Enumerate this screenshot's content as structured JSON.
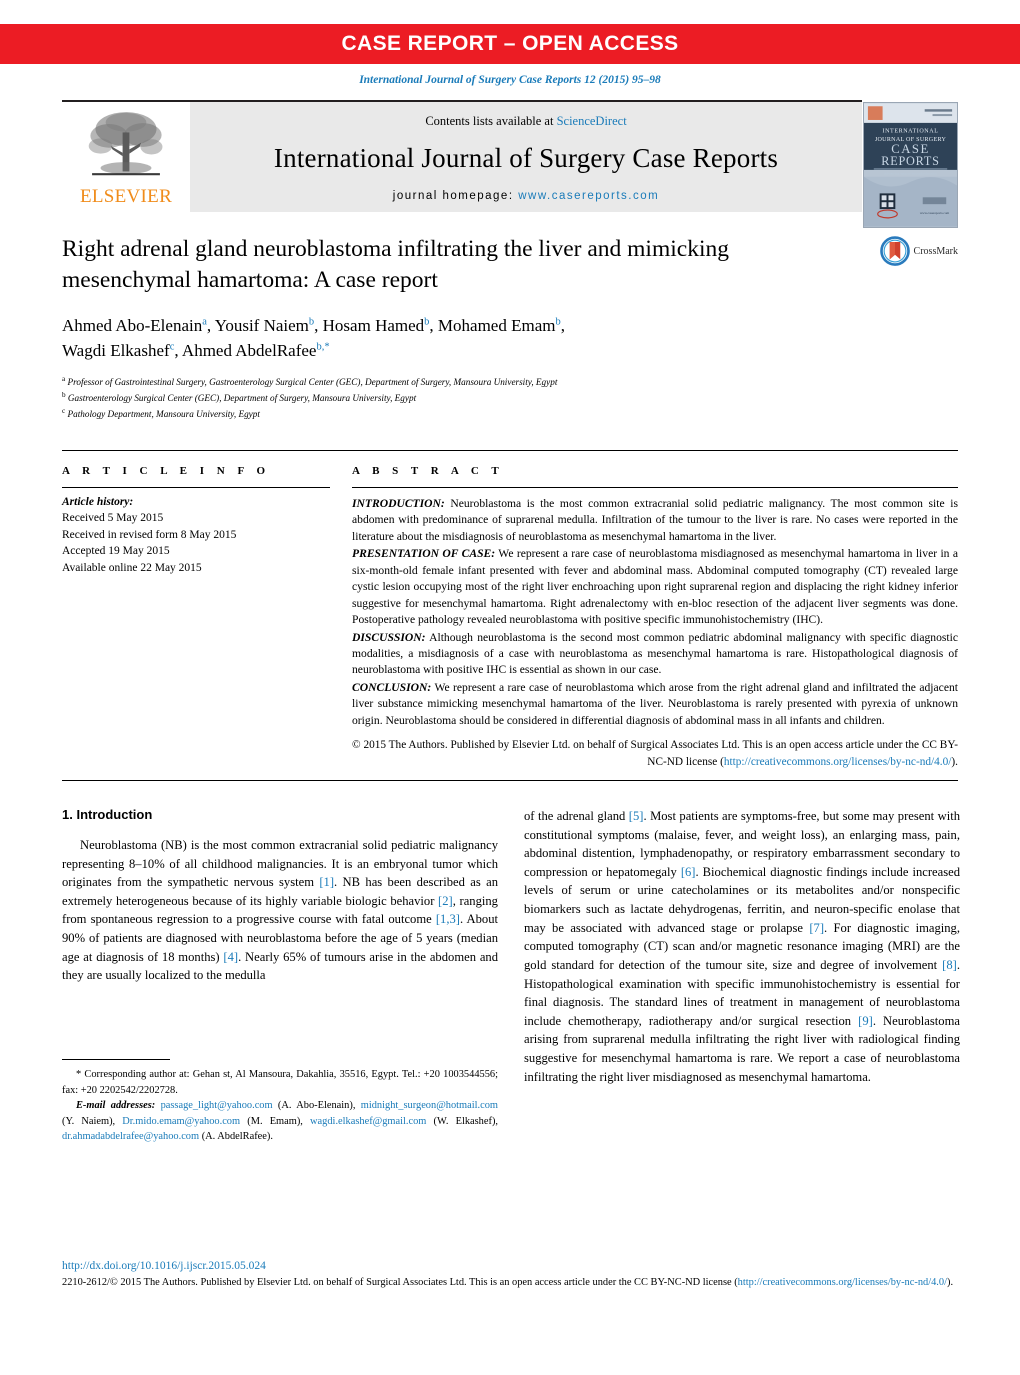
{
  "banner": {
    "text": "CASE REPORT – OPEN ACCESS",
    "color": "#ec1c24"
  },
  "journal_reference": "International Journal of Surgery Case Reports 12 (2015) 95–98",
  "masthead": {
    "publisher_name": "ELSEVIER",
    "contents_prefix": "Contents lists available at ",
    "contents_link": "ScienceDirect",
    "journal_title": "International Journal of Surgery Case Reports",
    "homepage_prefix": "journal homepage: ",
    "homepage_url": "www.casereports.com",
    "cover": {
      "line1": "INTERNATIONAL",
      "line2": "JOURNAL OF SURGERY",
      "line3": "CASE",
      "line4": "REPORTS",
      "tagline": "Advancing surgery through education"
    }
  },
  "article": {
    "title": "Right adrenal gland neuroblastoma infiltrating the liver and mimicking mesenchymal hamartoma: A case report",
    "authors": [
      {
        "name": "Ahmed Abo-Elenain",
        "marks": "a",
        "sep": ", "
      },
      {
        "name": "Yousif Naiem",
        "marks": "b",
        "sep": ", "
      },
      {
        "name": "Hosam Hamed",
        "marks": "b",
        "sep": ", "
      },
      {
        "name": "Mohamed Emam",
        "marks": "b",
        "sep": ","
      },
      {
        "name": "Wagdi Elkashef",
        "marks": "c",
        "sep": ", "
      },
      {
        "name": "Ahmed AbdelRafee",
        "marks": "b,*",
        "sep": ""
      }
    ],
    "affiliations": [
      {
        "mark": "a",
        "text": "Professor of Gastrointestinal Surgery, Gastroenterology Surgical Center (GEC), Department of Surgery, Mansoura University, Egypt"
      },
      {
        "mark": "b",
        "text": "Gastroenterology Surgical Center (GEC), Department of Surgery, Mansoura University, Egypt"
      },
      {
        "mark": "c",
        "text": "Pathology Department, Mansoura University, Egypt"
      }
    ],
    "crossmark_label": "CrossMark"
  },
  "article_info": {
    "heading": "A R T I C L E   I N F O",
    "history_title": "Article history:",
    "history": [
      "Received 5 May 2015",
      "Received in revised form 8 May 2015",
      "Accepted 19 May 2015",
      "Available online 22 May 2015"
    ]
  },
  "abstract": {
    "heading": "A B S T R A C T",
    "paragraphs": [
      {
        "lead": "INTRODUCTION:",
        "text": " Neuroblastoma is the most common extracranial solid pediatric malignancy. The most common site is abdomen with predominance of suprarenal medulla. Infiltration of the tumour to the liver is rare. No cases were reported in the literature about the misdiagnosis of neuroblastoma as mesenchymal hamartoma in the liver."
      },
      {
        "lead": "PRESENTATION OF CASE:",
        "text": " We represent a rare case of neuroblastoma misdiagnosed as mesenchymal hamartoma in liver in a six-month-old female infant presented with fever and abdominal mass. Abdominal computed tomography (CT) revealed large cystic lesion occupying most of the right liver enchroaching upon right suprarenal region and displacing the right kidney inferior suggestive for mesenchymal hamartoma. Right adrenalectomy with en-bloc resection of the adjacent liver segments was done. Postoperative pathology revealed neuroblastoma with positive specific immunohistochemistry (IHC)."
      },
      {
        "lead": "DISCUSSION:",
        "text": " Although neuroblastoma is the second most common pediatric abdominal malignancy with specific diagnostic modalities, a misdiagnosis of a case with neuroblastoma as mesenchymal hamartoma is rare. Histopathological diagnosis of neuroblastoma with positive IHC is essential as shown in our case."
      },
      {
        "lead": "CONCLUSION:",
        "text": " We represent a rare case of neuroblastoma which arose from the right adrenal gland and infiltrated the adjacent liver substance mimicking mesenchymal hamartoma of the liver. Neuroblastoma is rarely presented with pyrexia of unknown origin. Neuroblastoma should be considered in differential diagnosis of abdominal mass in all infants and children."
      }
    ],
    "copyright_text": "© 2015 The Authors. Published by Elsevier Ltd. on behalf of Surgical Associates Ltd. This is an open access article under the CC BY-NC-ND license (",
    "copyright_link": "http://creativecommons.org/licenses/by-nc-nd/4.0/",
    "copyright_suffix": ")."
  },
  "introduction": {
    "heading": "1.  Introduction",
    "left_paragraph_parts": [
      "Neuroblastoma (NB) is the most common extracranial solid pediatric malignancy representing 8–10% of all childhood malignancies. It is an embryonal tumor which originates from the sympathetic nervous system ",
      "[1]",
      ". NB has been described as an extremely heterogeneous because of its highly variable biologic behavior ",
      "[2]",
      ", ranging from spontaneous regression to a progressive course with fatal outcome ",
      "[1,3]",
      ". About 90% of patients are diagnosed with neuroblastoma before the age of 5 years (median age at diagnosis of 18 months) ",
      "[4]",
      ". Nearly 65% of tumours arise in the abdomen and they are usually localized to the medulla"
    ],
    "right_paragraph_parts": [
      "of the adrenal gland ",
      "[5]",
      ". Most patients are symptoms-free, but some may present with constitutional symptoms (malaise, fever, and weight loss), an enlarging mass, pain, abdominal distention, lymphadenopathy, or respiratory embarrassment secondary to compression or hepatomegaly ",
      "[6]",
      ". Biochemical diagnostic findings include increased levels of serum or urine catecholamines or its metabolites and/or nonspecific biomarkers such as lactate dehydrogenas, ferritin, and neuron-specific enolase that may be associated with advanced stage or prolapse ",
      "[7]",
      ". For diagnostic imaging, computed tomography (CT) scan and/or magnetic resonance imaging (MRI) are the gold standard for detection of the tumour site, size and degree of involvement ",
      "[8]",
      ". Histopathological examination with specific immunohistochemistry is essential for final diagnosis. The standard lines of treatment in management of neuroblastoma include chemotherapy, radiotherapy and/or surgical resection ",
      "[9]",
      ". Neuroblastoma arising from suprarenal medulla infiltrating the right liver with radiological finding suggestive for mesenchymal hamartoma is rare. We report a case of neuroblastoma infiltrating the right liver misdiagnosed as mesenchymal hamartoma."
    ]
  },
  "footnotes": {
    "corresponding": "*  Corresponding author at: Gehan st, Al Mansoura, Dakahlia, 35516, Egypt. Tel.: +20 1003544556; fax: +20 2202542/2202728.",
    "email_label": "E-mail addresses:",
    "emails": [
      {
        "address": "passage_light@yahoo.com",
        "owner": " (A. Abo-Elenain), "
      },
      {
        "address": "midnight_surgeon@hotmail.com",
        "owner": " (Y. Naiem), "
      },
      {
        "address": "Dr.mido.emam@yahoo.com",
        "owner": " (M. Emam), "
      },
      {
        "address": "wagdi.elkashef@gmail.com",
        "owner": " (W. Elkashef), "
      },
      {
        "address": "dr.ahmadabdelrafee@yahoo.com",
        "owner": " (A. AbdelRafee)."
      }
    ]
  },
  "page_footer": {
    "doi": "http://dx.doi.org/10.1016/j.ijscr.2015.05.024",
    "copyright_prefix": "2210-2612/© 2015 The Authors. Published by Elsevier Ltd. on behalf of Surgical Associates Ltd. This is an open access article under the CC BY-NC-ND license (",
    "copyright_link": "http://creativecommons.org/licenses/by-nc-nd/4.0/",
    "copyright_suffix": ")."
  },
  "colors": {
    "banner_red": "#ec1c24",
    "link_blue": "#1a7bb9",
    "elsevier_orange": "#f08c1b"
  }
}
